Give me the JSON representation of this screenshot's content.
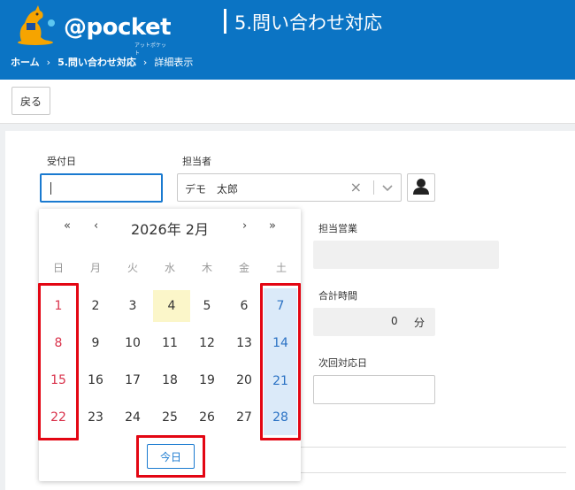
{
  "app": {
    "logo_text": "@pocket",
    "logo_sub": "アットポケット",
    "page_title": "5.問い合わせ対応",
    "colors": {
      "brand_blue": "#0b74c4",
      "sunday_red": "#d9324b",
      "saturday_blue": "#2b72c4",
      "highlight_red": "#e30613"
    }
  },
  "breadcrumb": {
    "home": "ホーム",
    "parent": "5.問い合わせ対応",
    "current": "詳細表示",
    "separator": "›"
  },
  "toolbar": {
    "back_label": "戻る"
  },
  "form": {
    "received_date_label": "受付日",
    "received_date_value": "",
    "assignee_label": "担当者",
    "assignee_value": "デモ　太郎",
    "sales_label": "担当営業",
    "sales_value": "",
    "total_time_label": "合計時間",
    "total_time_value": "0",
    "total_time_unit": "分",
    "next_date_label": "次回対応日",
    "next_date_value": ""
  },
  "calendar": {
    "nav_prev_year": "«",
    "nav_prev_month": "‹",
    "nav_next_month": "›",
    "nav_next_year": "»",
    "title": "2026年 2月",
    "weekdays": [
      "日",
      "月",
      "火",
      "水",
      "木",
      "金",
      "土"
    ],
    "weeks": [
      [
        "1",
        "2",
        "3",
        "4",
        "5",
        "6",
        "7"
      ],
      [
        "8",
        "9",
        "10",
        "11",
        "12",
        "13",
        "14"
      ],
      [
        "15",
        "16",
        "17",
        "18",
        "19",
        "20",
        "21"
      ],
      [
        "22",
        "23",
        "24",
        "25",
        "26",
        "27",
        "28"
      ]
    ],
    "today_day": "4",
    "today_label": "今日"
  }
}
